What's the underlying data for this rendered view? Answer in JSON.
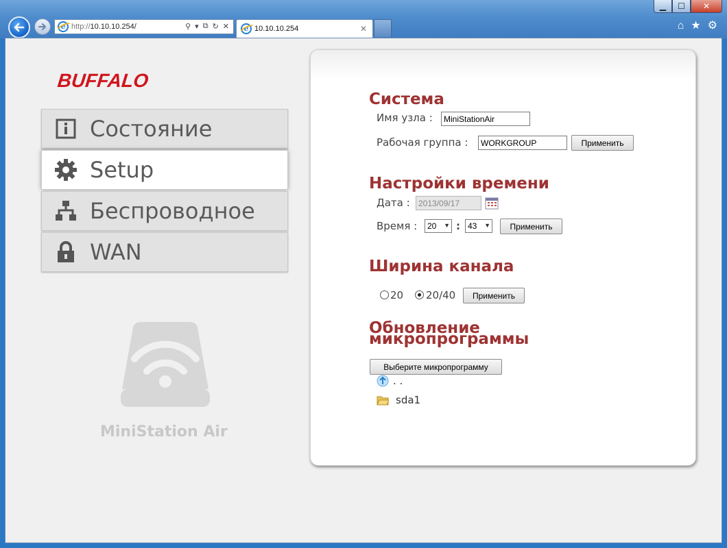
{
  "browser": {
    "address_prefix": "http://",
    "address_host": "10.10.10.254/",
    "tab_title": "10.10.10.254"
  },
  "brand": {
    "logo": "BUFFALO",
    "device_name": "MiniStation Air"
  },
  "sidebar": {
    "items": [
      {
        "label": "Состояние",
        "icon": "info-icon"
      },
      {
        "label": "Setup",
        "icon": "gear-icon",
        "active": true
      },
      {
        "label": "Беспроводное",
        "icon": "network-icon"
      },
      {
        "label": "WAN",
        "icon": "lock-icon"
      }
    ]
  },
  "system": {
    "title": "Система",
    "hostname_label": "Имя узла :",
    "hostname_value": "MiniStationAir",
    "workgroup_label": "Рабочая группа :",
    "workgroup_value": "WORKGROUP",
    "apply": "Применить"
  },
  "time": {
    "title": "Настройки времени",
    "date_label": "Дата :",
    "date_value": "2013/09/17",
    "time_label": "Время :",
    "hour": "20",
    "colon": ":",
    "minute": "43",
    "apply": "Применить"
  },
  "channel": {
    "title": "Ширина канала",
    "option1": "20",
    "option2": "20/40",
    "selected": "20/40",
    "apply": "Применить"
  },
  "firmware": {
    "title_line1": "Обновление",
    "title_line2": "микропрограммы",
    "select_button": "Выберите микропрограмму",
    "entries": [
      ".  .",
      "sda1"
    ]
  },
  "colors": {
    "section_title": "#9e3333",
    "brand": "#d0151d"
  }
}
